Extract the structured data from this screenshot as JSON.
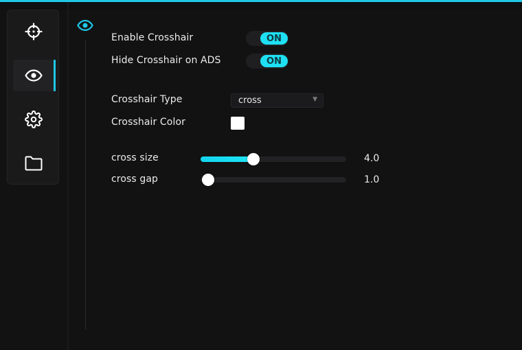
{
  "theme": {
    "accent": "#1ec8e6",
    "background": "#121213",
    "panel": "#1a1a1b"
  },
  "sidebar": {
    "items": [
      {
        "icon": "crosshair-icon",
        "active": false
      },
      {
        "icon": "eye-icon",
        "active": true
      },
      {
        "icon": "gear-icon",
        "active": false
      },
      {
        "icon": "folder-icon",
        "active": false
      }
    ]
  },
  "section": {
    "icon": "eye-icon"
  },
  "settings": {
    "enable_crosshair": {
      "label": "Enable Crosshair",
      "state": "ON"
    },
    "hide_on_ads": {
      "label": "Hide Crosshair on ADS",
      "state": "ON"
    },
    "crosshair_type": {
      "label": "Crosshair Type",
      "value": "cross"
    },
    "crosshair_color": {
      "label": "Crosshair Color",
      "color": "#ffffff"
    },
    "cross_size": {
      "label": "cross size",
      "value": "4.0",
      "fraction": 0.34
    },
    "cross_gap": {
      "label": "cross gap",
      "value": "1.0",
      "fraction": 0.0
    }
  }
}
